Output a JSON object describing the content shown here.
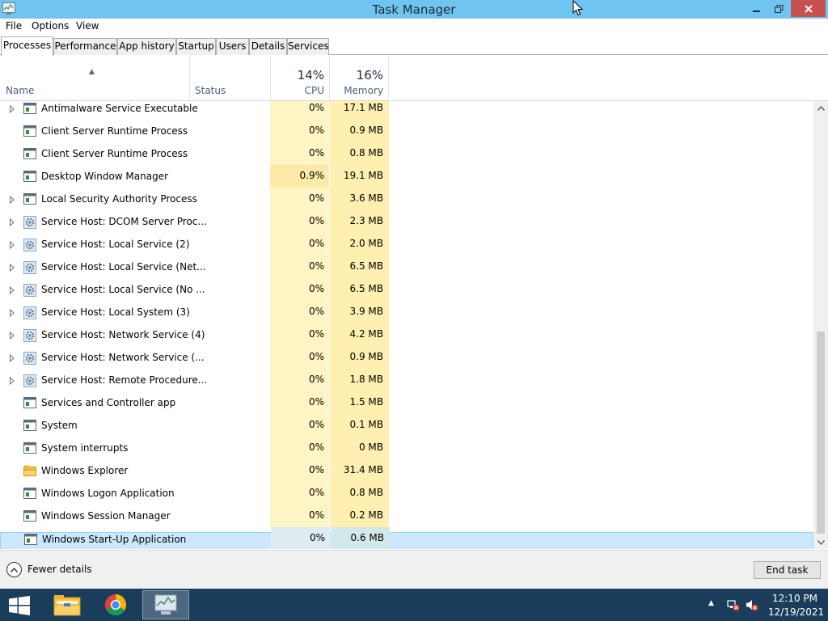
{
  "window": {
    "title": "Task Manager"
  },
  "menu": {
    "items": [
      "File",
      "Options",
      "View"
    ]
  },
  "tabs": [
    {
      "label": "Processes",
      "active": true
    },
    {
      "label": "Performance",
      "active": false
    },
    {
      "label": "App history",
      "active": false
    },
    {
      "label": "Startup",
      "active": false
    },
    {
      "label": "Users",
      "active": false
    },
    {
      "label": "Details",
      "active": false
    },
    {
      "label": "Services",
      "active": false
    }
  ],
  "columns": {
    "name": "Name",
    "status": "Status",
    "cpu_pct": "14%",
    "cpu": "CPU",
    "mem_pct": "16%",
    "mem": "Memory"
  },
  "processes": [
    {
      "name": "Antimalware Service Executable",
      "cpu": "0%",
      "memory": "17.1 MB",
      "expandable": true,
      "icon": "app-window-icon"
    },
    {
      "name": "Client Server Runtime Process",
      "cpu": "0%",
      "memory": "0.9 MB",
      "expandable": false,
      "icon": "app-window-icon"
    },
    {
      "name": "Client Server Runtime Process",
      "cpu": "0%",
      "memory": "0.8 MB",
      "expandable": false,
      "icon": "app-window-icon"
    },
    {
      "name": "Desktop Window Manager",
      "cpu": "0.9%",
      "memory": "19.1 MB",
      "expandable": false,
      "icon": "app-window-icon"
    },
    {
      "name": "Local Security Authority Process",
      "cpu": "0%",
      "memory": "3.6 MB",
      "expandable": true,
      "icon": "app-window-icon"
    },
    {
      "name": "Service Host: DCOM Server Proc...",
      "cpu": "0%",
      "memory": "2.3 MB",
      "expandable": true,
      "icon": "gear-icon"
    },
    {
      "name": "Service Host: Local Service (2)",
      "cpu": "0%",
      "memory": "2.0 MB",
      "expandable": true,
      "icon": "gear-icon"
    },
    {
      "name": "Service Host: Local Service (Net...",
      "cpu": "0%",
      "memory": "6.5 MB",
      "expandable": true,
      "icon": "gear-icon"
    },
    {
      "name": "Service Host: Local Service (No ...",
      "cpu": "0%",
      "memory": "6.5 MB",
      "expandable": true,
      "icon": "gear-icon"
    },
    {
      "name": "Service Host: Local System (3)",
      "cpu": "0%",
      "memory": "3.9 MB",
      "expandable": true,
      "icon": "gear-icon"
    },
    {
      "name": "Service Host: Network Service (4)",
      "cpu": "0%",
      "memory": "4.2 MB",
      "expandable": true,
      "icon": "gear-icon"
    },
    {
      "name": "Service Host: Network Service (...",
      "cpu": "0%",
      "memory": "0.9 MB",
      "expandable": true,
      "icon": "gear-icon"
    },
    {
      "name": "Service Host: Remote Procedure...",
      "cpu": "0%",
      "memory": "1.8 MB",
      "expandable": true,
      "icon": "gear-icon"
    },
    {
      "name": "Services and Controller app",
      "cpu": "0%",
      "memory": "1.5 MB",
      "expandable": false,
      "icon": "app-window-icon"
    },
    {
      "name": "System",
      "cpu": "0%",
      "memory": "0.1 MB",
      "expandable": false,
      "icon": "app-window-icon"
    },
    {
      "name": "System interrupts",
      "cpu": "0%",
      "memory": "0 MB",
      "expandable": false,
      "icon": "app-window-icon"
    },
    {
      "name": "Windows Explorer",
      "cpu": "0%",
      "memory": "31.4 MB",
      "expandable": false,
      "icon": "folder-icon"
    },
    {
      "name": "Windows Logon Application",
      "cpu": "0%",
      "memory": "0.8 MB",
      "expandable": false,
      "icon": "app-window-icon"
    },
    {
      "name": "Windows Session Manager",
      "cpu": "0%",
      "memory": "0.2 MB",
      "expandable": false,
      "icon": "app-window-icon"
    },
    {
      "name": "Windows Start-Up Application",
      "cpu": "0%",
      "memory": "0.6 MB",
      "expandable": false,
      "icon": "app-window-icon",
      "selected": true
    }
  ],
  "footer": {
    "fewer_details": "Fewer details",
    "end_task": "End task"
  },
  "taskbar": {
    "time": "12:10 PM",
    "date": "12/19/2021",
    "apps": [
      "file-explorer-icon",
      "chrome-icon",
      "task-manager-icon"
    ]
  },
  "colors": {
    "titlebar": "#6fc4f0",
    "close_button": "#c75050",
    "cpu_heat": "#fff4c4",
    "mem_heat": "#ffefb0",
    "selection": "#cce8ff",
    "taskbar": "#1b3d5c"
  }
}
